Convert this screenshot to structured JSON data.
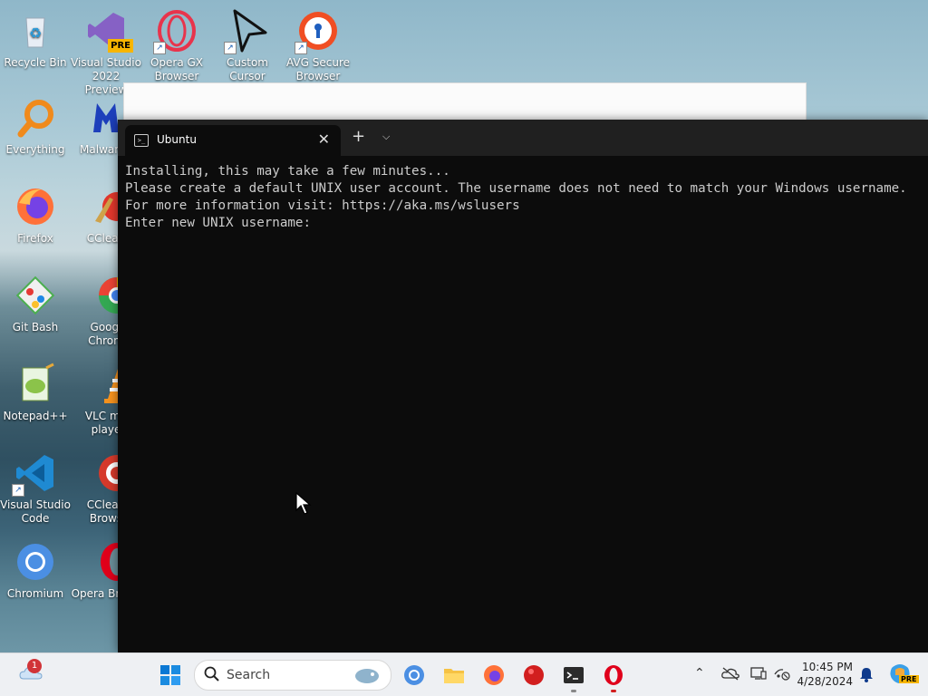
{
  "desktop": {
    "icons": [
      {
        "label": "Recycle Bin"
      },
      {
        "label": "Visual Studio 2022 Preview",
        "badge": "PRE"
      },
      {
        "label": "Opera GX Browser"
      },
      {
        "label": "Custom Cursor"
      },
      {
        "label": "AVG Secure Browser"
      },
      {
        "label": "Everything"
      },
      {
        "label": "Malwareb"
      },
      {
        "label": "Firefox"
      },
      {
        "label": "CClean"
      },
      {
        "label": "Git Bash"
      },
      {
        "label": "Googl Chrom"
      },
      {
        "label": "Notepad++"
      },
      {
        "label": "VLC me playe"
      },
      {
        "label": "Visual Studio Code"
      },
      {
        "label": "CClean Brows"
      },
      {
        "label": "Chromium"
      },
      {
        "label": "Opera Brows"
      }
    ]
  },
  "terminal": {
    "tab_title": "Ubuntu",
    "close_glyph": "✕",
    "new_tab_glyph": "+",
    "dropdown_glyph": "⌵",
    "output": "Installing, this may take a few minutes...\nPlease create a default UNIX user account. The username does not need to match your Windows username.\nFor more information visit: https://aka.ms/wslusers\nEnter new UNIX username: "
  },
  "taskbar": {
    "weather_badge": "1",
    "search_label": "Search",
    "time": "10:45 PM",
    "date": "4/28/2024",
    "copilot_badge": "PRE"
  },
  "colors": {
    "terminal_bg": "#0c0c0c",
    "tabbar_bg": "#202020",
    "accent": "#0067c0"
  }
}
